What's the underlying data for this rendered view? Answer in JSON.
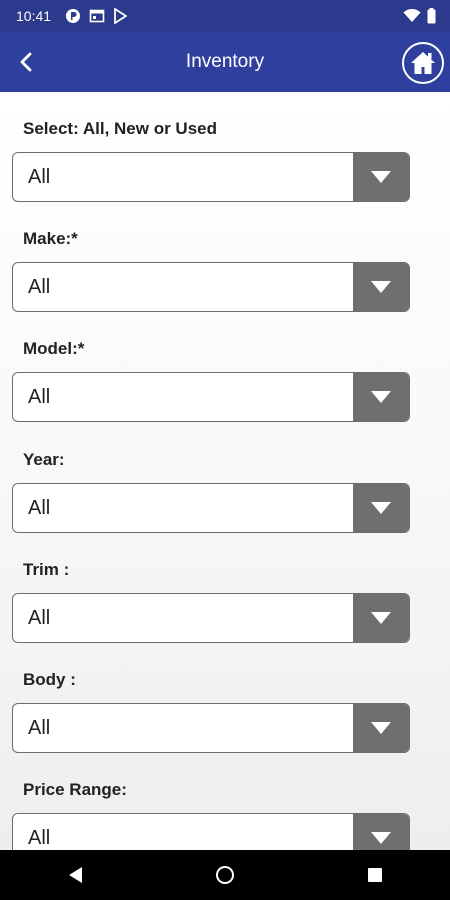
{
  "status_bar": {
    "time": "10:41",
    "icons": [
      "app-icon",
      "calendar-icon",
      "play-store-icon"
    ],
    "right_icons": [
      "wifi-icon",
      "battery-icon"
    ]
  },
  "app_bar": {
    "title": "Inventory",
    "back_icon": "back-chevron-icon",
    "home_icon": "home-icon"
  },
  "form": {
    "fields": [
      {
        "label": "Select: All, New or Used",
        "value": "All"
      },
      {
        "label": "Make:*",
        "value": "All"
      },
      {
        "label": "Model:*",
        "value": "All"
      },
      {
        "label": "Year:",
        "value": "All"
      },
      {
        "label": "Trim :",
        "value": "All"
      },
      {
        "label": "Body :",
        "value": "All"
      },
      {
        "label": "Price Range:",
        "value": "All"
      }
    ]
  },
  "nav_bar": {
    "buttons": [
      "back-triangle-icon",
      "home-circle-icon",
      "recents-square-icon"
    ]
  }
}
